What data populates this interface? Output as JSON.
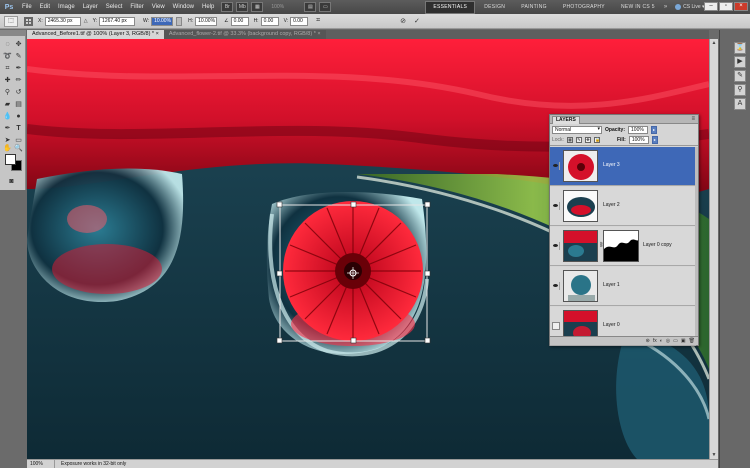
{
  "app": {
    "logo": "Ps"
  },
  "menu": [
    "File",
    "Edit",
    "Image",
    "Layer",
    "Select",
    "Filter",
    "View",
    "Window",
    "Help"
  ],
  "menubar": {
    "zoom": "100%",
    "workspaces": [
      "ESSENTIALS",
      "DESIGN",
      "PAINTING",
      "PHOTOGRAPHY",
      "NEW IN CS 5"
    ],
    "active_workspace": "ESSENTIALS",
    "more": "»",
    "cs_live": "CS Live ▾",
    "window_buttons": [
      "–",
      "▫",
      "×"
    ]
  },
  "options": {
    "x_label": "X:",
    "x_value": "2465.30 px",
    "y_label": "Y:",
    "y_value": "1267.40 px",
    "w_label": "W:",
    "w_value": "10.00%",
    "h_label": "H:",
    "h_value": "10.00%",
    "angle_value": "0.00",
    "hskew_label": "H:",
    "hskew_value": "0.00",
    "vskew_label": "V:",
    "vskew_value": "0.00",
    "cancel_symbol": "⊘",
    "commit_symbol": "✓"
  },
  "tabs": [
    {
      "label": "Advanced_Before1.tif @ 100% (Layer 3, RGB/8) *",
      "close": "×",
      "active": true
    },
    {
      "label": "Advanced_flower-2.tif @ 33.3% (background copy, RGB/8) *",
      "close": "×",
      "active": false
    }
  ],
  "status": {
    "zoom": "100%",
    "message": "Exposure works in 32-bit only"
  },
  "layers_panel": {
    "title": "LAYERS",
    "menu": "≡",
    "blend_mode": "Normal",
    "opacity_label": "Opacity:",
    "opacity_value": "100%",
    "lock_label": "Lock:",
    "fill_label": "Fill:",
    "fill_value": "100%",
    "footer_icons": [
      "⊛",
      "fx",
      "◐",
      "◎",
      "▭",
      "▣",
      "🗑"
    ],
    "layers": [
      {
        "name": "Layer 3",
        "visible": true,
        "selected": true
      },
      {
        "name": "Layer 2",
        "visible": true,
        "selected": false
      },
      {
        "name": "Layer 0 copy",
        "visible": true,
        "selected": false,
        "has_mask": true
      },
      {
        "name": "Layer 1",
        "visible": true,
        "selected": false
      },
      {
        "name": "Layer 0",
        "visible": false,
        "selected": false
      }
    ]
  },
  "colors": {
    "selected_layer": "#3e68b7",
    "petal_red": "#e0102a",
    "water_teal": "#1b3f4f"
  }
}
